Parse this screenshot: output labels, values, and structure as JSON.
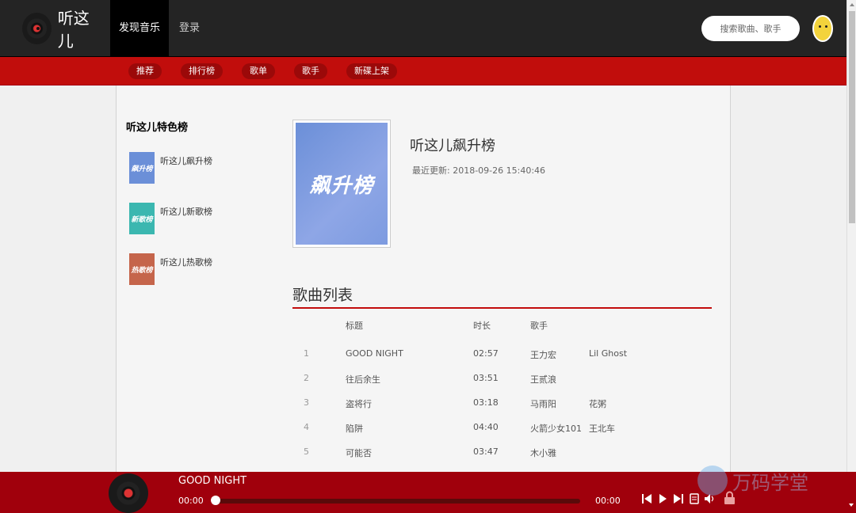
{
  "header": {
    "logo_text": "听这儿",
    "nav": [
      "发现音乐",
      "登录"
    ],
    "search_placeholder": "搜索歌曲、歌手"
  },
  "subnav": [
    "推荐",
    "排行榜",
    "歌单",
    "歌手",
    "新碟上架"
  ],
  "sidebar": {
    "title": "听这儿特色榜",
    "items": [
      {
        "label": "听这儿飙升榜",
        "thumb": "飙升榜",
        "color": "#6b8fd8"
      },
      {
        "label": "听这儿新歌榜",
        "thumb": "新歌榜",
        "color": "#3bb7b0"
      },
      {
        "label": "听这儿热歌榜",
        "thumb": "热歌榜",
        "color": "#c5654b"
      }
    ]
  },
  "playlist": {
    "cover_text": "飙升榜",
    "title": "听这儿飙升榜",
    "updated_label": "最近更新:",
    "updated_value": "2018-09-26 15:40:46"
  },
  "songs": {
    "heading": "歌曲列表",
    "columns": [
      "标题",
      "时长",
      "歌手"
    ],
    "rows": [
      {
        "num": "1",
        "title": "GOOD NIGHT",
        "duration": "02:57",
        "artist1": "王力宏",
        "artist2": "Lil Ghost"
      },
      {
        "num": "2",
        "title": "往后余生",
        "duration": "03:51",
        "artist1": "王贰浪",
        "artist2": ""
      },
      {
        "num": "3",
        "title": "盗将行",
        "duration": "03:18",
        "artist1": "马雨阳",
        "artist2": "花粥"
      },
      {
        "num": "4",
        "title": "陷阱",
        "duration": "04:40",
        "artist1": "火箭少女101",
        "artist2": "王北车"
      },
      {
        "num": "5",
        "title": "可能否",
        "duration": "03:47",
        "artist1": "木小雅",
        "artist2": ""
      }
    ]
  },
  "player": {
    "track_title": "GOOD NIGHT",
    "current_time": "00:00",
    "total_time": "00:00",
    "progress": 0,
    "accent_color": "#a0000c"
  },
  "watermark": "万码学堂",
  "colors": {
    "header_bg": "#242424",
    "subnav_bg": "#c10d0c",
    "pill_bg": "#9b0909",
    "player_bg": "#a0000c"
  }
}
